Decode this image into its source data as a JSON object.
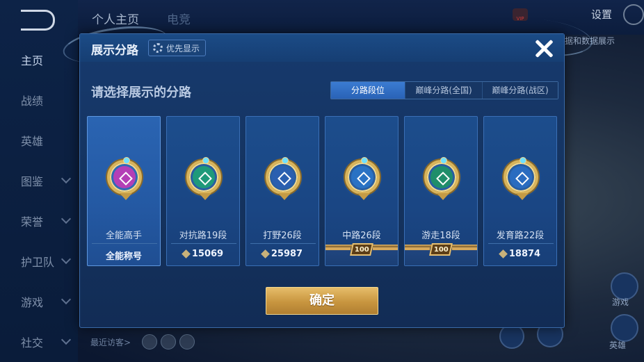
{
  "background": {
    "sidebar_items": [
      {
        "label": "主页",
        "active": true
      },
      {
        "label": "战绩"
      },
      {
        "label": "英雄"
      },
      {
        "label": "图鉴",
        "chevron": true
      },
      {
        "label": "荣誉",
        "chevron": true
      },
      {
        "label": "护卫队",
        "chevron": true
      },
      {
        "label": "游戏",
        "chevron": true
      },
      {
        "label": "社交",
        "chevron": true
      }
    ],
    "top_tabs": [
      "个人主页",
      "电竞"
    ],
    "settings_label": "设置",
    "vip_label": "VIP",
    "right_text": "据和数据展示",
    "visitors_label": "最近访客>",
    "right_labels": [
      "游戏",
      "英雄"
    ]
  },
  "modal": {
    "title": "展示分路",
    "priority_label": "优先显示",
    "subtitle": "请选择展示的分路",
    "segments": [
      {
        "label": "分路段位",
        "active": true
      },
      {
        "label": "巅峰分路(全国)",
        "active": false
      },
      {
        "label": "巅峰分路(战区)",
        "active": false
      }
    ],
    "cards": [
      {
        "label": "全能高手",
        "value": "全能称号",
        "value_type": "text",
        "selected": true,
        "icon": "all-round-badge-icon",
        "color": "#b43fb6"
      },
      {
        "label": "对抗路19段",
        "value": "15069",
        "value_type": "points",
        "icon": "clash-lane-badge-icon",
        "color": "#1f9a7a"
      },
      {
        "label": "打野26段",
        "value": "25987",
        "value_type": "points",
        "icon": "jungle-badge-icon",
        "color": "#2a5fb0"
      },
      {
        "label": "中路26段",
        "value": "100",
        "value_type": "hundred",
        "icon": "mid-lane-badge-icon",
        "color": "#2a72c4"
      },
      {
        "label": "游走18段",
        "value": "100",
        "value_type": "hundred",
        "icon": "roam-badge-icon",
        "color": "#1f8e6a"
      },
      {
        "label": "发育路22段",
        "value": "18874",
        "value_type": "points",
        "icon": "farm-lane-badge-icon",
        "color": "#2a6cc0"
      }
    ],
    "confirm_label": "确定"
  }
}
